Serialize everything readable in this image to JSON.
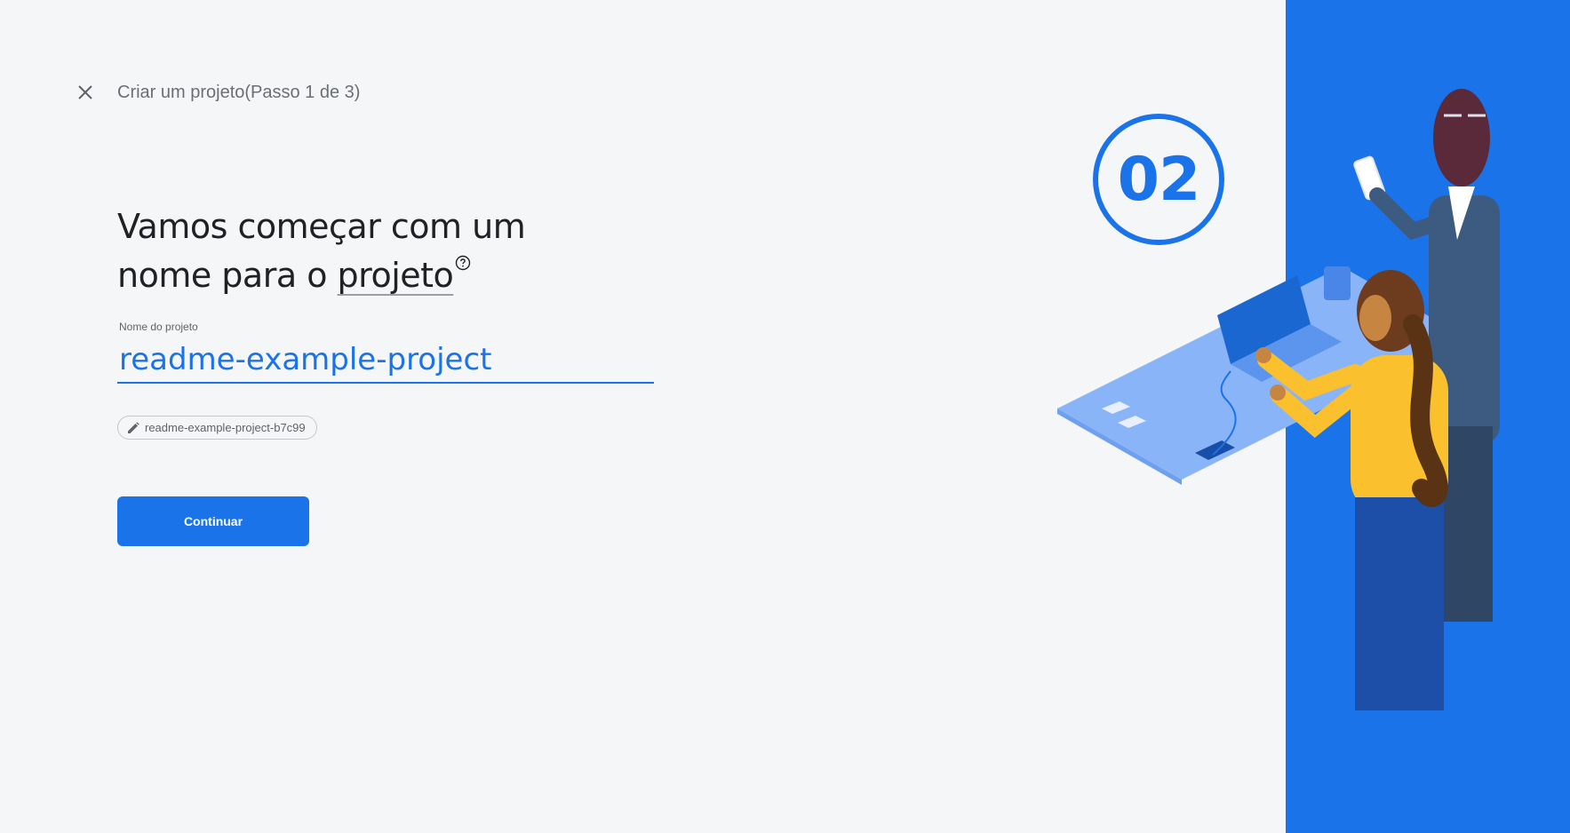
{
  "header": {
    "close_icon": "close-icon",
    "title": "Criar um projeto(Passo 1 de 3)"
  },
  "headline": {
    "line1": "Vamos começar com um",
    "line2_prefix": "nome para o ",
    "term": "projeto",
    "help_icon": "help-circle-icon"
  },
  "project_name": {
    "label": "Nome do projeto",
    "value": "readme-example-project"
  },
  "project_id_chip": {
    "icon": "pencil-icon",
    "text": "readme-example-project-b7c99"
  },
  "continue_label": "Continuar",
  "step_badge": "02",
  "colors": {
    "accent": "#1a73e8",
    "background": "#f5f6f8",
    "panel": "#1a73e8",
    "text": "#202124",
    "muted": "#5f6368"
  }
}
